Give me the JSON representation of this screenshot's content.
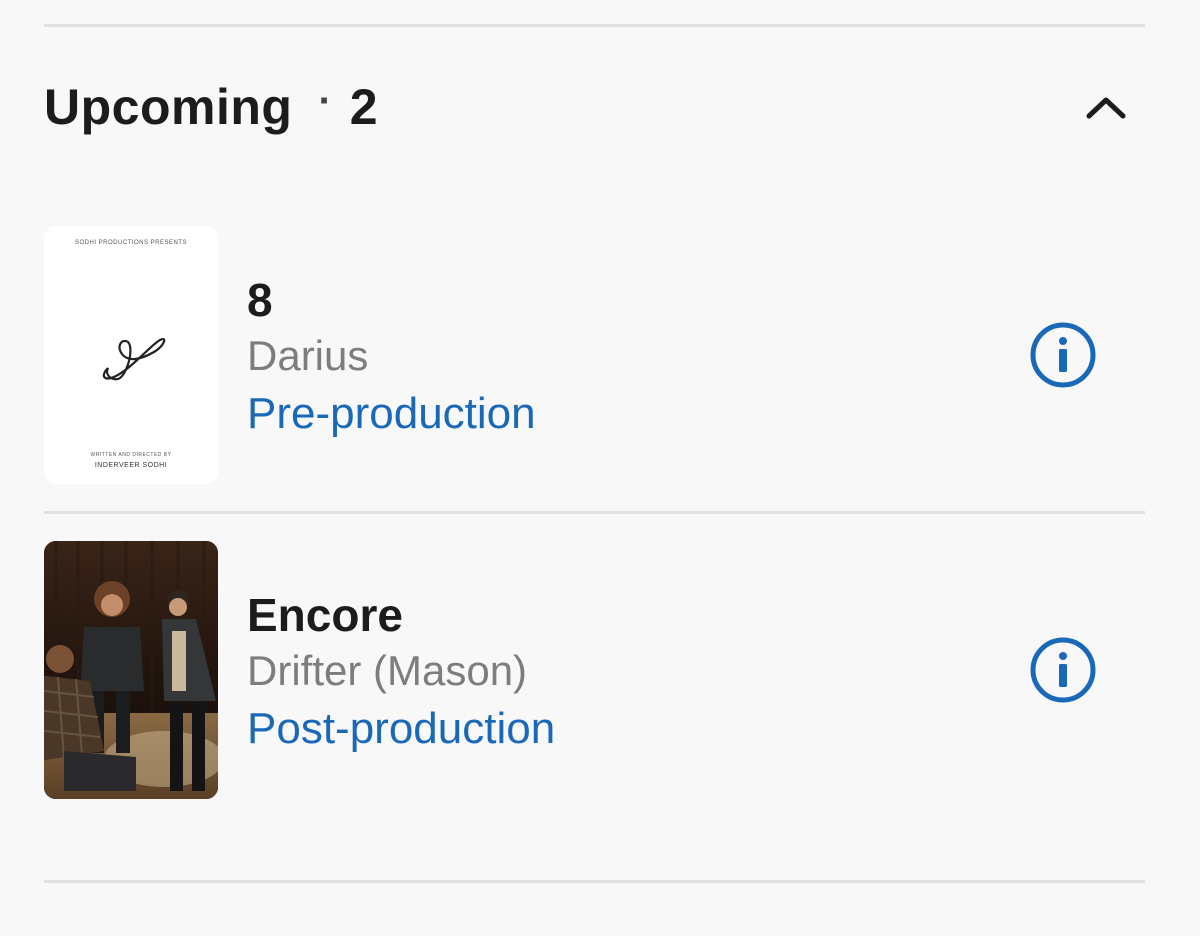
{
  "section": {
    "title": "Upcoming",
    "separator": "·",
    "count": "2",
    "collapse_icon": "chevron-up-icon"
  },
  "projects": [
    {
      "title": "8",
      "role": "Darius",
      "status": "Pre-production",
      "poster": {
        "top_text": "SODHI PRODUCTIONS PRESENTS",
        "credit_line": "WRITTEN AND DIRECTED BY",
        "credit_name": "INDERVEER SODHI",
        "logo": "8"
      },
      "info_icon": "info-icon"
    },
    {
      "title": "Encore",
      "role": "Drifter (Mason)",
      "status": "Post-production",
      "poster": {
        "type": "photo",
        "description_icon": "stage-photo"
      },
      "info_icon": "info-icon"
    }
  ],
  "colors": {
    "background": "#f8f8f8",
    "divider": "#e1e1e1",
    "title": "#1c1c1c",
    "secondary": "#7d7d7d",
    "accent": "#1a69b8"
  }
}
